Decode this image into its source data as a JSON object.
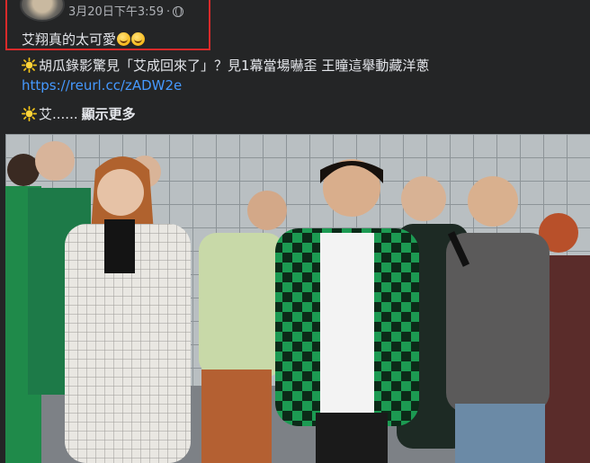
{
  "post": {
    "timestamp": "3月20日下午3:59",
    "separator": "·",
    "caption": "艾翔真的太可愛",
    "headline": "胡瓜錄影驚見「艾成回來了」？見1幕當場嚇歪 王瞳這舉動藏洋蔥",
    "link": "https://reurl.cc/zADW2e",
    "preview": "艾......",
    "see_more": "顯示更多"
  },
  "icons": {
    "globe": "globe-icon",
    "emoji": "grinning-face-icon",
    "sun": "sun-icon"
  },
  "colors": {
    "background": "#242526",
    "highlight_border": "#d92a2a",
    "link": "#4599ff"
  }
}
